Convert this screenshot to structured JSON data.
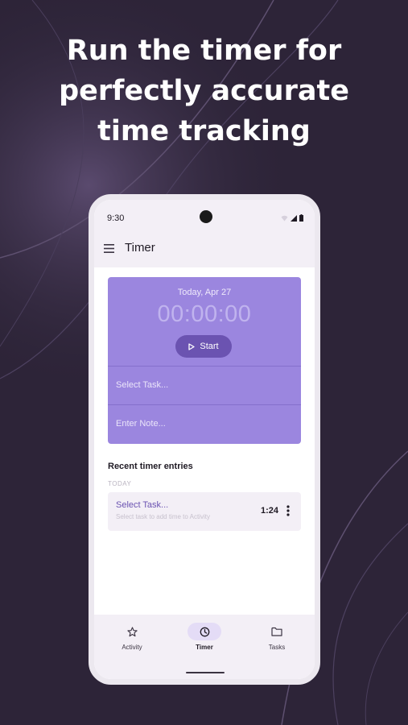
{
  "headline": {
    "line1": "Run the timer for",
    "line2": "perfectly accurate",
    "line3": "time tracking"
  },
  "colors": {
    "background": "#2d2438",
    "accent": "#9b86df",
    "accent_dark": "#6b53b1"
  },
  "status_bar": {
    "time": "9:30"
  },
  "app_bar": {
    "title": "Timer",
    "menu_icon": "menu-icon"
  },
  "timer": {
    "date": "Today, Apr 27",
    "elapsed": "00:00:00",
    "start_label": "Start",
    "task_placeholder": "Select Task...",
    "note_placeholder": "Enter Note..."
  },
  "recent": {
    "title": "Recent timer entries",
    "groups": [
      {
        "label": "TODAY",
        "entries": [
          {
            "task": "Select Task...",
            "hint": "Select task to add time to Activity",
            "duration": "1:24"
          }
        ]
      }
    ]
  },
  "bottom_nav": {
    "items": [
      {
        "label": "Activity",
        "icon": "star-icon",
        "active": false
      },
      {
        "label": "Timer",
        "icon": "clock-icon",
        "active": true
      },
      {
        "label": "Tasks",
        "icon": "folder-icon",
        "active": false
      }
    ]
  }
}
